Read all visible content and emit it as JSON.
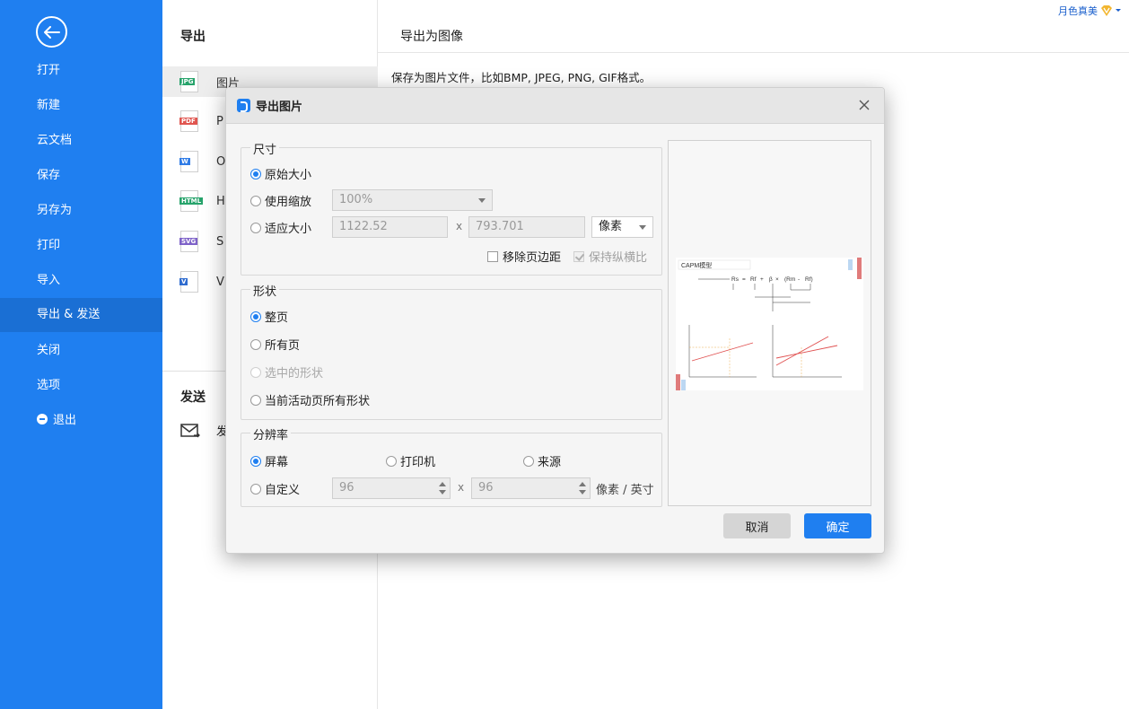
{
  "user": {
    "name": "月色真美"
  },
  "sidebar": {
    "items": [
      {
        "label": "打开"
      },
      {
        "label": "新建"
      },
      {
        "label": "云文档"
      },
      {
        "label": "保存"
      },
      {
        "label": "另存为"
      },
      {
        "label": "打印"
      },
      {
        "label": "导入"
      },
      {
        "label": "导出 & 发送"
      },
      {
        "label": "关闭"
      },
      {
        "label": "选项"
      },
      {
        "label": "退出"
      }
    ]
  },
  "export_panel": {
    "title": "导出",
    "formats": [
      {
        "icon_text": "JPG",
        "label": "图片",
        "color": "#27a36b"
      },
      {
        "icon_text": "PDF",
        "label": "P",
        "color": "#e0554f"
      },
      {
        "icon_text": "W",
        "label": "O",
        "color": "#2f7be6"
      },
      {
        "icon_text": "HTML",
        "label": "H",
        "color": "#27a36b"
      },
      {
        "icon_text": "SVG",
        "label": "S",
        "color": "#7e62c8"
      },
      {
        "icon_text": "V",
        "label": "V",
        "color": "#2f6ccf"
      }
    ],
    "send_title": "发送",
    "send_item": "发"
  },
  "content": {
    "title": "导出为图像",
    "description": "保存为图片文件，比如BMP, JPEG, PNG, GIF格式。"
  },
  "dialog": {
    "title": "导出图片",
    "size": {
      "label": "尺寸",
      "original": "原始大小",
      "use_scale": "使用缩放",
      "scale_value": "100%",
      "fit_size": "适应大小",
      "width": "1122.52",
      "x": "x",
      "height": "793.701",
      "unit": "像素",
      "remove_margin": "移除页边距",
      "keep_ratio": "保持纵横比"
    },
    "shape": {
      "label": "形状",
      "whole_page": "整页",
      "all_pages": "所有页",
      "selected": "选中的形状",
      "current_all": "当前活动页所有形状"
    },
    "resolution": {
      "label": "分辨率",
      "screen": "屏幕",
      "printer": "打印机",
      "source": "来源",
      "custom": "自定义",
      "dpi_x": "96",
      "x": "x",
      "dpi_y": "96",
      "unit": "像素 / 英寸"
    },
    "preview": {
      "doc_title": "CAPM模型",
      "formula": [
        "Rs",
        "=",
        "Rf",
        "+",
        "β",
        "×",
        "(Rm",
        "-",
        "Rf)"
      ]
    },
    "cancel": "取消",
    "ok": "确定"
  }
}
